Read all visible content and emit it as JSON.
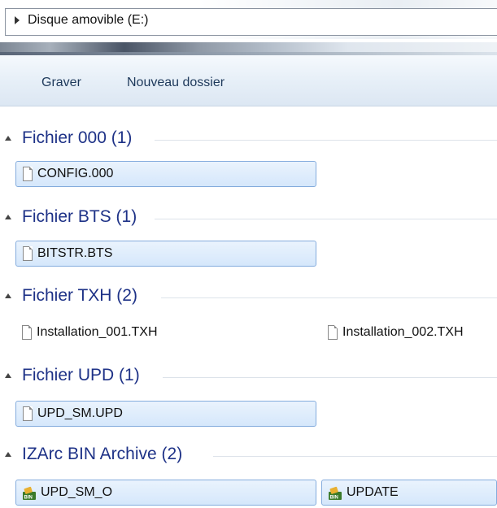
{
  "address": {
    "path": "Disque amovible (E:)"
  },
  "toolbar": {
    "burn_label": "Graver",
    "new_folder_label": "Nouveau dossier"
  },
  "groups": [
    {
      "title": "Fichier 000 (1)",
      "files": [
        "CONFIG.000"
      ]
    },
    {
      "title": "Fichier BTS (1)",
      "files": [
        "BITSTR.BTS"
      ]
    },
    {
      "title": "Fichier TXH (2)",
      "files": [
        "Installation_001.TXH",
        "Installation_002.TXH"
      ]
    },
    {
      "title": "Fichier UPD (1)",
      "files": [
        "UPD_SM.UPD"
      ]
    },
    {
      "title": "IZArc BIN Archive (2)",
      "files": [
        "UPD_SM_O",
        "UPDATE"
      ]
    }
  ],
  "icons": {
    "address_arrow": "chevron-right-icon",
    "group_toggle": "collapse-triangle-icon",
    "file": "document-icon",
    "archive": "izarc-bin-archive-icon"
  },
  "colors": {
    "group_title": "#1e3287",
    "selection_fill": "#d5e7fb",
    "selection_border": "#84acdd",
    "toolbar_text": "#1e395b"
  }
}
